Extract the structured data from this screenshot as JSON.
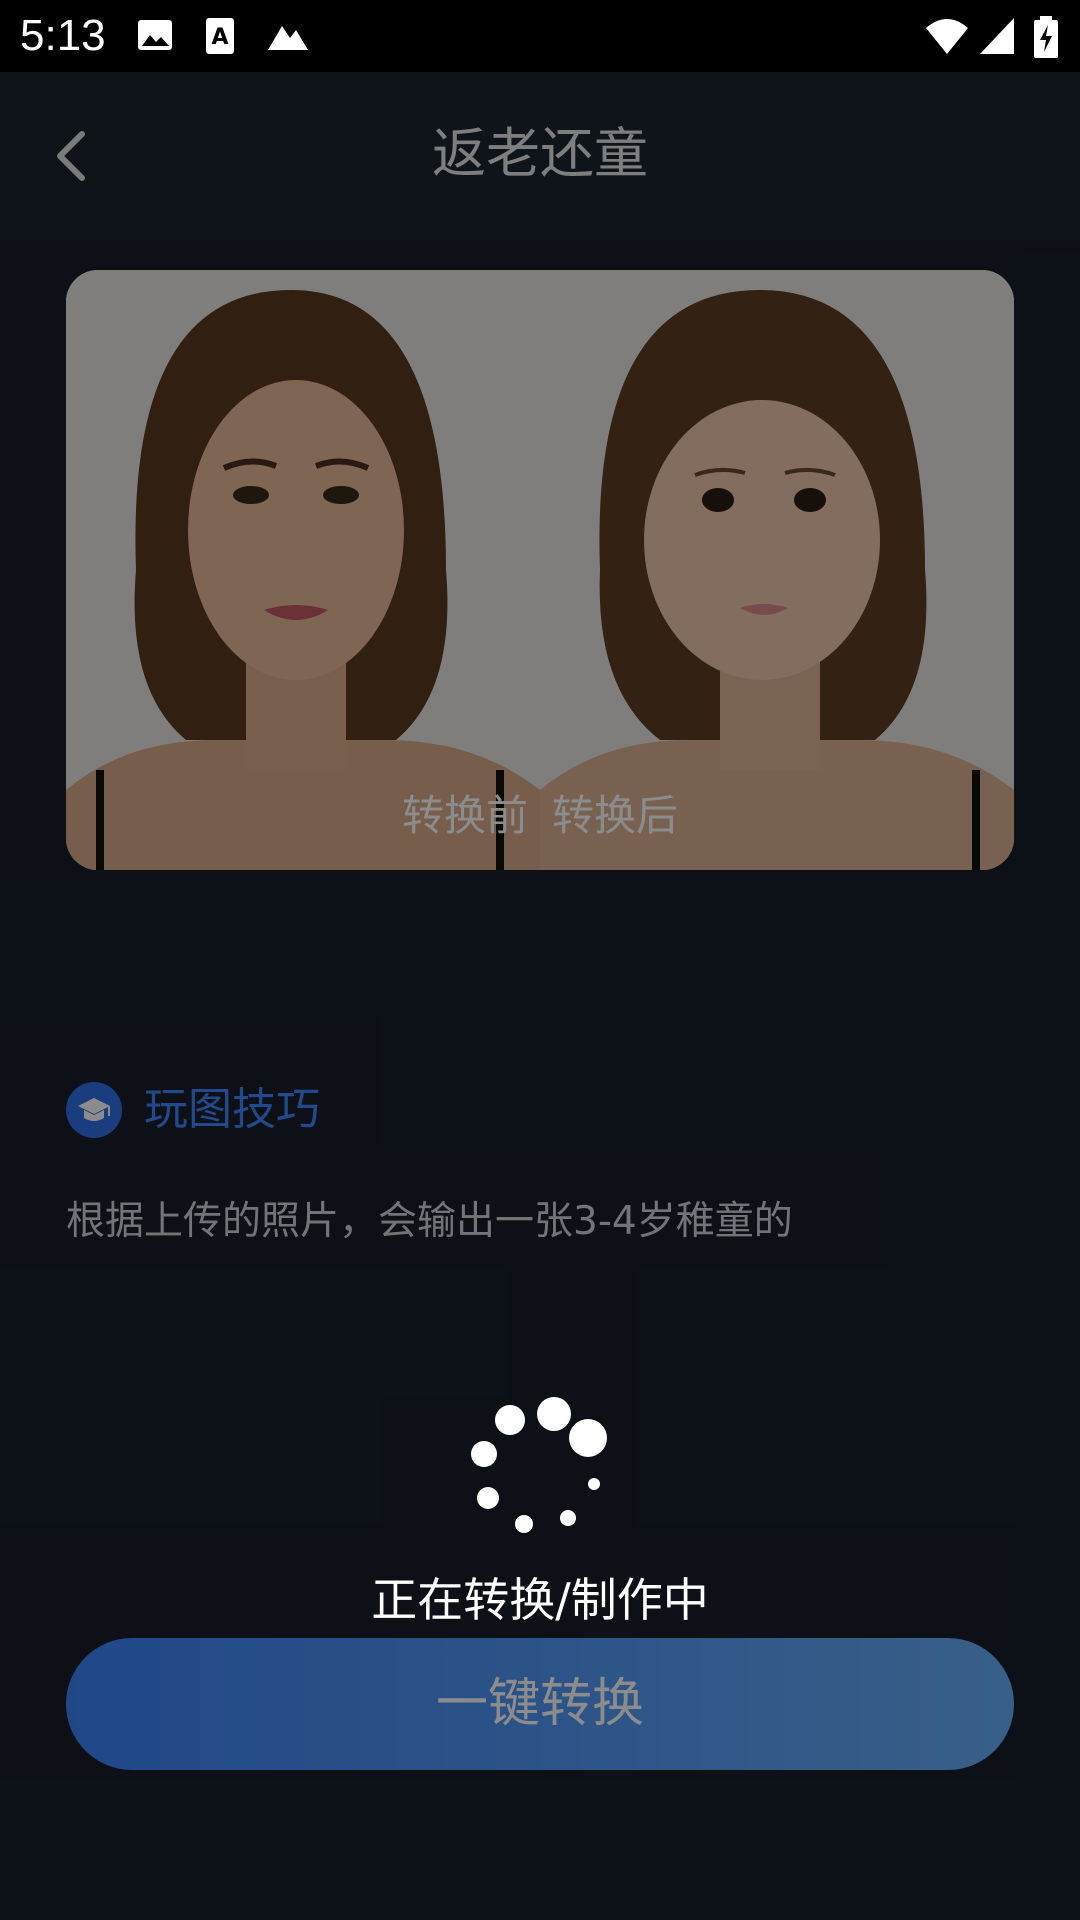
{
  "status_bar": {
    "time": "5:13",
    "left_icons": [
      "image-icon",
      "a-icon",
      "mountain-icon"
    ],
    "right_icons": [
      "wifi-icon",
      "signal-icon",
      "battery-charging-icon"
    ]
  },
  "header": {
    "title": "返老还童",
    "back_icon": "chevron-left-icon"
  },
  "comparison": {
    "before_label": "转换前",
    "after_label": "转换后"
  },
  "tips": {
    "title": "玩图技巧",
    "icon": "graduation-cap-icon",
    "description": "根据上传的照片，会输出一张3-4岁稚童的"
  },
  "action": {
    "convert_label": "一键转换"
  },
  "loading": {
    "text": "正在转换/制作中"
  },
  "colors": {
    "background": "#181f2b",
    "accent_blue": "#3d86ff",
    "button_gradient_start": "#3b82f6",
    "button_gradient_end": "#68aef7"
  }
}
